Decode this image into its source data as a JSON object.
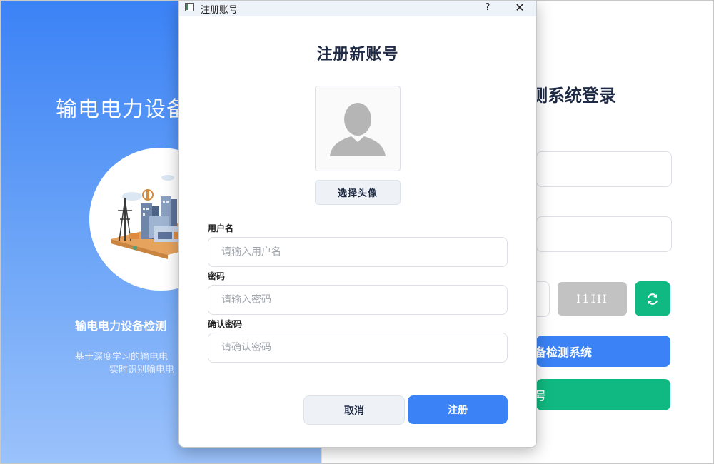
{
  "background_window": {
    "app_title": "输电电力设备",
    "subtitle": "输电电力设备检测",
    "description_line1": "基于深度学习的输电电",
    "description_line2": "实时识别输电电",
    "login_title": "测系统登录",
    "captcha_text": "I1IH",
    "login_button_label": "备检测系统",
    "register_button_label": "号",
    "refresh_icon": "refresh-icon",
    "colors": {
      "blue": "#3b82f6",
      "green": "#10b981",
      "captcha_gray": "#c2c2c2"
    }
  },
  "dialog": {
    "window_title": "注册账号",
    "help_label": "?",
    "close_label": "✕",
    "heading": "注册新账号",
    "avatar_icon": "user-silhouette-icon",
    "choose_avatar_label": "选择头像",
    "fields": {
      "username_label": "用户名",
      "username_placeholder": "请输入用户名",
      "password_label": "密码",
      "password_placeholder": "请输入密码",
      "confirm_label": "确认密码",
      "confirm_placeholder": "请确认密码"
    },
    "cancel_label": "取消",
    "submit_label": "注册"
  }
}
